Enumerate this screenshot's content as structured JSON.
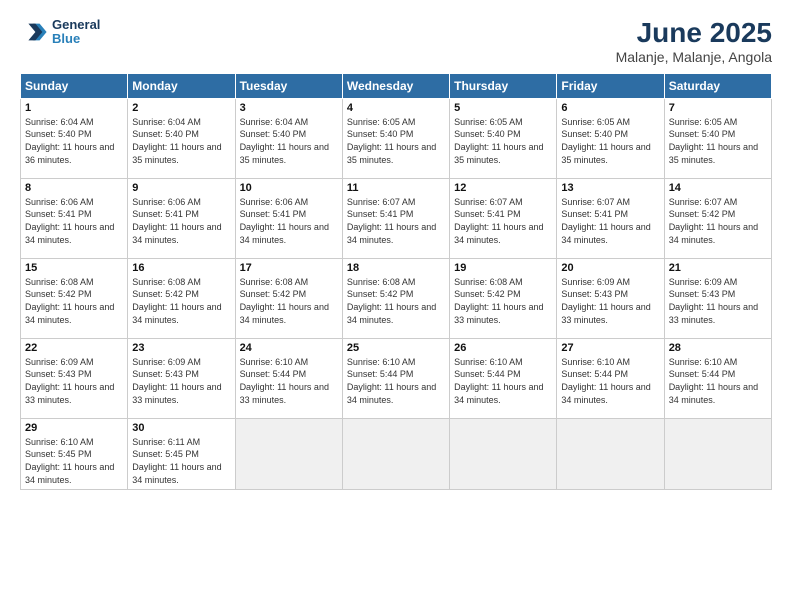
{
  "logo": {
    "line1": "General",
    "line2": "Blue"
  },
  "title": "June 2025",
  "location": "Malanje, Malanje, Angola",
  "weekdays": [
    "Sunday",
    "Monday",
    "Tuesday",
    "Wednesday",
    "Thursday",
    "Friday",
    "Saturday"
  ],
  "weeks": [
    [
      {
        "day": "1",
        "sunrise": "6:04 AM",
        "sunset": "5:40 PM",
        "daylight": "11 hours and 36 minutes."
      },
      {
        "day": "2",
        "sunrise": "6:04 AM",
        "sunset": "5:40 PM",
        "daylight": "11 hours and 35 minutes."
      },
      {
        "day": "3",
        "sunrise": "6:04 AM",
        "sunset": "5:40 PM",
        "daylight": "11 hours and 35 minutes."
      },
      {
        "day": "4",
        "sunrise": "6:05 AM",
        "sunset": "5:40 PM",
        "daylight": "11 hours and 35 minutes."
      },
      {
        "day": "5",
        "sunrise": "6:05 AM",
        "sunset": "5:40 PM",
        "daylight": "11 hours and 35 minutes."
      },
      {
        "day": "6",
        "sunrise": "6:05 AM",
        "sunset": "5:40 PM",
        "daylight": "11 hours and 35 minutes."
      },
      {
        "day": "7",
        "sunrise": "6:05 AM",
        "sunset": "5:40 PM",
        "daylight": "11 hours and 35 minutes."
      }
    ],
    [
      {
        "day": "8",
        "sunrise": "6:06 AM",
        "sunset": "5:41 PM",
        "daylight": "11 hours and 34 minutes."
      },
      {
        "day": "9",
        "sunrise": "6:06 AM",
        "sunset": "5:41 PM",
        "daylight": "11 hours and 34 minutes."
      },
      {
        "day": "10",
        "sunrise": "6:06 AM",
        "sunset": "5:41 PM",
        "daylight": "11 hours and 34 minutes."
      },
      {
        "day": "11",
        "sunrise": "6:07 AM",
        "sunset": "5:41 PM",
        "daylight": "11 hours and 34 minutes."
      },
      {
        "day": "12",
        "sunrise": "6:07 AM",
        "sunset": "5:41 PM",
        "daylight": "11 hours and 34 minutes."
      },
      {
        "day": "13",
        "sunrise": "6:07 AM",
        "sunset": "5:41 PM",
        "daylight": "11 hours and 34 minutes."
      },
      {
        "day": "14",
        "sunrise": "6:07 AM",
        "sunset": "5:42 PM",
        "daylight": "11 hours and 34 minutes."
      }
    ],
    [
      {
        "day": "15",
        "sunrise": "6:08 AM",
        "sunset": "5:42 PM",
        "daylight": "11 hours and 34 minutes."
      },
      {
        "day": "16",
        "sunrise": "6:08 AM",
        "sunset": "5:42 PM",
        "daylight": "11 hours and 34 minutes."
      },
      {
        "day": "17",
        "sunrise": "6:08 AM",
        "sunset": "5:42 PM",
        "daylight": "11 hours and 34 minutes."
      },
      {
        "day": "18",
        "sunrise": "6:08 AM",
        "sunset": "5:42 PM",
        "daylight": "11 hours and 34 minutes."
      },
      {
        "day": "19",
        "sunrise": "6:08 AM",
        "sunset": "5:42 PM",
        "daylight": "11 hours and 33 minutes."
      },
      {
        "day": "20",
        "sunrise": "6:09 AM",
        "sunset": "5:43 PM",
        "daylight": "11 hours and 33 minutes."
      },
      {
        "day": "21",
        "sunrise": "6:09 AM",
        "sunset": "5:43 PM",
        "daylight": "11 hours and 33 minutes."
      }
    ],
    [
      {
        "day": "22",
        "sunrise": "6:09 AM",
        "sunset": "5:43 PM",
        "daylight": "11 hours and 33 minutes."
      },
      {
        "day": "23",
        "sunrise": "6:09 AM",
        "sunset": "5:43 PM",
        "daylight": "11 hours and 33 minutes."
      },
      {
        "day": "24",
        "sunrise": "6:10 AM",
        "sunset": "5:44 PM",
        "daylight": "11 hours and 33 minutes."
      },
      {
        "day": "25",
        "sunrise": "6:10 AM",
        "sunset": "5:44 PM",
        "daylight": "11 hours and 34 minutes."
      },
      {
        "day": "26",
        "sunrise": "6:10 AM",
        "sunset": "5:44 PM",
        "daylight": "11 hours and 34 minutes."
      },
      {
        "day": "27",
        "sunrise": "6:10 AM",
        "sunset": "5:44 PM",
        "daylight": "11 hours and 34 minutes."
      },
      {
        "day": "28",
        "sunrise": "6:10 AM",
        "sunset": "5:44 PM",
        "daylight": "11 hours and 34 minutes."
      }
    ],
    [
      {
        "day": "29",
        "sunrise": "6:10 AM",
        "sunset": "5:45 PM",
        "daylight": "11 hours and 34 minutes."
      },
      {
        "day": "30",
        "sunrise": "6:11 AM",
        "sunset": "5:45 PM",
        "daylight": "11 hours and 34 minutes."
      },
      null,
      null,
      null,
      null,
      null
    ]
  ]
}
